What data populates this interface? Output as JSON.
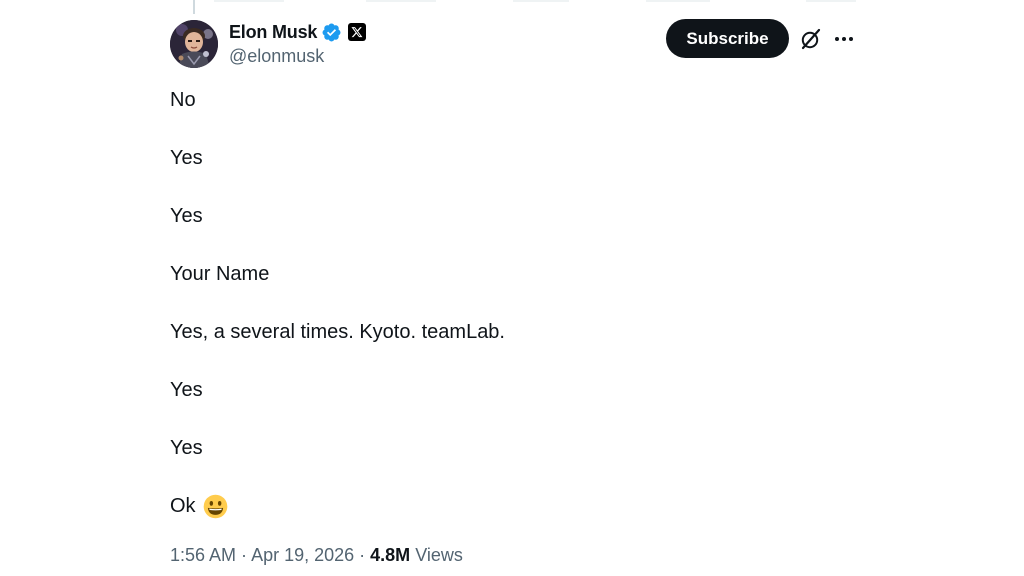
{
  "author": {
    "display_name": "Elon Musk",
    "handle": "@elonmusk",
    "verified_icon": "verified-badge-icon",
    "affiliation_icon": "x-logo-icon"
  },
  "actions": {
    "subscribe_label": "Subscribe",
    "grok_icon": "grok-icon",
    "more_icon": "more-horizontal-icon"
  },
  "post": {
    "lines": [
      "No",
      "Yes",
      "Yes",
      "Your Name",
      "Yes, a several times. Kyoto. teamLab.",
      "Yes",
      "Yes",
      "Ok"
    ],
    "emoji": "grinning-face-emoji"
  },
  "meta": {
    "time": "1:56 AM",
    "separator": " · ",
    "date": "Apr 19, 2026",
    "views_count": "4.8M",
    "views_label": "Views"
  },
  "colors": {
    "text_primary": "#0f1419",
    "text_secondary": "#536471",
    "verified_blue": "#1d9bf0",
    "button_bg": "#0f1419"
  }
}
